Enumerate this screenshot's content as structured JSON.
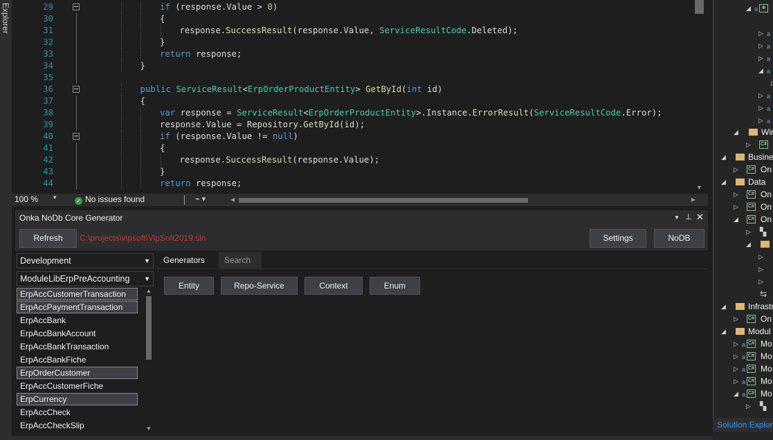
{
  "left_strip": {
    "label": "Explorer"
  },
  "editor": {
    "lines": [
      {
        "n": "29",
        "indent": 2,
        "tokens": [
          [
            "kw",
            "if"
          ],
          [
            "p",
            " (response.Value > "
          ],
          [
            "num",
            "0"
          ],
          [
            "p",
            ")"
          ]
        ],
        "fold": true
      },
      {
        "n": "30",
        "indent": 2,
        "tokens": [
          [
            "p",
            "{"
          ]
        ]
      },
      {
        "n": "31",
        "indent": 3,
        "tokens": [
          [
            "p",
            "response."
          ],
          [
            "fn",
            "SuccessResult"
          ],
          [
            "p",
            "(response.Value, "
          ],
          [
            "ty",
            "ServiceResultCode"
          ],
          [
            "p",
            ".Deleted);"
          ]
        ]
      },
      {
        "n": "32",
        "indent": 2,
        "tokens": [
          [
            "p",
            "}"
          ]
        ]
      },
      {
        "n": "33",
        "indent": 2,
        "tokens": [
          [
            "kw",
            "return"
          ],
          [
            "p",
            " response;"
          ]
        ]
      },
      {
        "n": "34",
        "indent": 1,
        "tokens": [
          [
            "p",
            "}"
          ]
        ]
      },
      {
        "n": "35",
        "indent": 0,
        "tokens": []
      },
      {
        "n": "36",
        "indent": 1,
        "tokens": [
          [
            "kw",
            "public"
          ],
          [
            "p",
            " "
          ],
          [
            "ty",
            "ServiceResult"
          ],
          [
            "p",
            "<"
          ],
          [
            "ty",
            "ErpOrderProductEntity"
          ],
          [
            "p",
            "> "
          ],
          [
            "fn",
            "GetById"
          ],
          [
            "p",
            "("
          ],
          [
            "kw",
            "int"
          ],
          [
            "p",
            " id)"
          ]
        ],
        "fold": true
      },
      {
        "n": "37",
        "indent": 1,
        "tokens": [
          [
            "p",
            "{"
          ]
        ]
      },
      {
        "n": "38",
        "indent": 2,
        "tokens": [
          [
            "kw",
            "var"
          ],
          [
            "p",
            " response = "
          ],
          [
            "ty",
            "ServiceResult"
          ],
          [
            "p",
            "<"
          ],
          [
            "ty",
            "ErpOrderProductEntity"
          ],
          [
            "p",
            ">.Instance."
          ],
          [
            "fn",
            "ErrorResult"
          ],
          [
            "p",
            "("
          ],
          [
            "ty",
            "ServiceResultCode"
          ],
          [
            "p",
            ".Error);"
          ]
        ]
      },
      {
        "n": "39",
        "indent": 2,
        "tokens": [
          [
            "p",
            "response.Value = Repository."
          ],
          [
            "fn",
            "GetById"
          ],
          [
            "p",
            "(id);"
          ]
        ]
      },
      {
        "n": "40",
        "indent": 2,
        "tokens": [
          [
            "kw",
            "if"
          ],
          [
            "p",
            " (response.Value != "
          ],
          [
            "kw",
            "null"
          ],
          [
            "p",
            ")"
          ]
        ],
        "fold": true
      },
      {
        "n": "41",
        "indent": 2,
        "tokens": [
          [
            "p",
            "{"
          ]
        ]
      },
      {
        "n": "42",
        "indent": 3,
        "tokens": [
          [
            "p",
            "response."
          ],
          [
            "fn",
            "SuccessResult"
          ],
          [
            "p",
            "(response.Value);"
          ]
        ]
      },
      {
        "n": "43",
        "indent": 2,
        "tokens": [
          [
            "p",
            "}"
          ]
        ]
      },
      {
        "n": "44",
        "indent": 2,
        "tokens": [
          [
            "kw",
            "return"
          ],
          [
            "p",
            " response;"
          ]
        ]
      }
    ]
  },
  "status": {
    "zoom": "100 %",
    "issues": "No issues found"
  },
  "tool_window": {
    "title": "Onka NoDb Core Generator",
    "refresh_label": "Refresh",
    "solution_path": "C:\\projects\\vipsoft\\VipSoft2019.sln",
    "settings_label": "Settings",
    "nodb_label": "NoDB",
    "environment_select": "Development",
    "module_select": "ModuleLibErpPreAccounting",
    "entities": [
      {
        "name": "ErpAccCustomerTransaction",
        "selected": true
      },
      {
        "name": "ErpAccPaymentTransaction",
        "selected": true
      },
      {
        "name": "ErpAccBank",
        "selected": false
      },
      {
        "name": "ErpAccBankAccount",
        "selected": false
      },
      {
        "name": "ErpAccBankTransaction",
        "selected": false
      },
      {
        "name": "ErpAccBankFiche",
        "selected": false
      },
      {
        "name": "ErpOrderCustomer",
        "selected": true
      },
      {
        "name": "ErpAccCustomerFiche",
        "selected": false
      },
      {
        "name": "ErpCurrency",
        "selected": true
      },
      {
        "name": "ErpAccCheck",
        "selected": false
      },
      {
        "name": "ErpAccCheckSlip",
        "selected": false
      }
    ],
    "tabs": {
      "generators": "Generators",
      "search": "Search"
    },
    "generator_buttons": {
      "entity": "Entity",
      "repo_service": "Repo-Service",
      "context": "Context",
      "enum": "Enum"
    }
  },
  "solution_explorer": {
    "rows": [
      {
        "label": "Wir"
      },
      {
        "label": "Busine"
      },
      {
        "label": "On"
      },
      {
        "label": "Data"
      },
      {
        "label": "On"
      },
      {
        "label": "On"
      },
      {
        "label": "On"
      },
      {
        "label": "Infrastr"
      },
      {
        "label": "On"
      },
      {
        "label": "Modul"
      },
      {
        "label": "Mo"
      },
      {
        "label": "Mo"
      },
      {
        "label": "Mo"
      },
      {
        "label": "Mo"
      },
      {
        "label": "Mo"
      }
    ],
    "footer": "Solution Explor"
  },
  "colors": {
    "accent": "#007acc",
    "path_red": "#c0392b",
    "line_number": "#2b91af",
    "keyword": "#569cd6",
    "type": "#4ec9b0",
    "method": "#dcdcaa"
  }
}
